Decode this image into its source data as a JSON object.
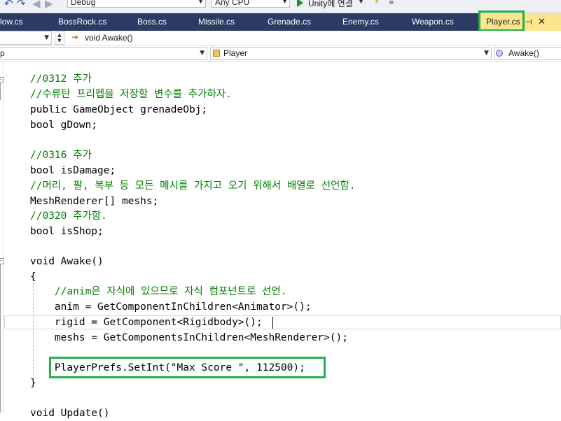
{
  "toolbar": {
    "config": "Debug",
    "platform": "Any CPU",
    "run_target": "Unity에 연결"
  },
  "tabs": [
    "low.cs",
    "BossRock.cs",
    "Boss.cs",
    "Missile.cs",
    "Grenade.cs",
    "Enemy.cs",
    "Weapon.cs",
    "Player.cs"
  ],
  "nav": {
    "member_text": "void Awake()",
    "left_scope": "p",
    "class_scope": "Player",
    "method_scope": "Awake()"
  },
  "code": [
    "//0312 추가",
    "//수류탄 프리펩을 저장할 변수를 추가하자.",
    "public GameObject grenadeObj;",
    "bool gDown;",
    "",
    "//0316 추가",
    "bool isDamage;",
    "//머리, 팔, 복부 등 모든 메시를 가지고 오기 위해서 배열로 선언함.",
    "MeshRenderer[] meshs;",
    "//0320 추가함.",
    "bool isShop;",
    "",
    "void Awake()",
    "{",
    "    //anim은 자식에 있으므로 자식 컴포넌트로 선언.",
    "    anim = GetComponentInChildren<Animator>();",
    "    rigid = GetComponent<Rigidbody>();",
    "    meshs = GetComponentsInChildren<MeshRenderer>();",
    "",
    "    PlayerPrefs.SetInt(\"Max Score \", 112500);",
    "}",
    "",
    "void Update()"
  ]
}
